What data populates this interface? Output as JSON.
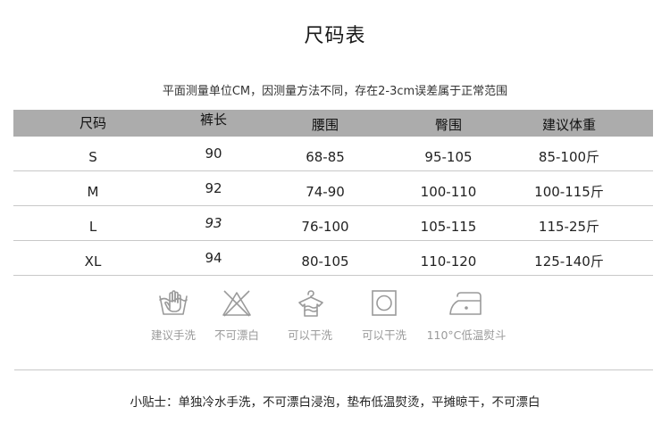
{
  "title": "尺码表",
  "subtitle": "平面测量单位CM，因测量方法不同，存在2-3cm误差属于正常范围",
  "table": {
    "headers": [
      "尺码",
      "裤长",
      "腰围",
      "臀围",
      "建议体重"
    ],
    "rows": [
      [
        "S",
        "90",
        "68-85",
        "95-105",
        "85-100斤"
      ],
      [
        "M",
        "92",
        "74-90",
        "100-110",
        "100-115斤"
      ],
      [
        "L",
        "93",
        "76-100",
        "105-115",
        "115-25斤"
      ],
      [
        "XL",
        "94",
        "80-105",
        "110-120",
        "125-140斤"
      ]
    ]
  },
  "care": [
    {
      "icon": "hand-wash-icon",
      "label": "建议手洗"
    },
    {
      "icon": "no-bleach-icon",
      "label": "不可漂白"
    },
    {
      "icon": "dry-clean-icon",
      "label": "可以干洗"
    },
    {
      "icon": "tumble-dry-icon",
      "label": "可以干洗"
    },
    {
      "icon": "iron-low-icon",
      "label": "110°C低温熨斗"
    }
  ],
  "tip": "小贴士：单独冷水手洗，不可漂白浸泡，垫布低温熨烫，平摊晾干，不可漂白",
  "colors": {
    "header_bg": "#acacac",
    "icon_gray": "#9a9a9a",
    "divider": "#c8c8c8"
  }
}
